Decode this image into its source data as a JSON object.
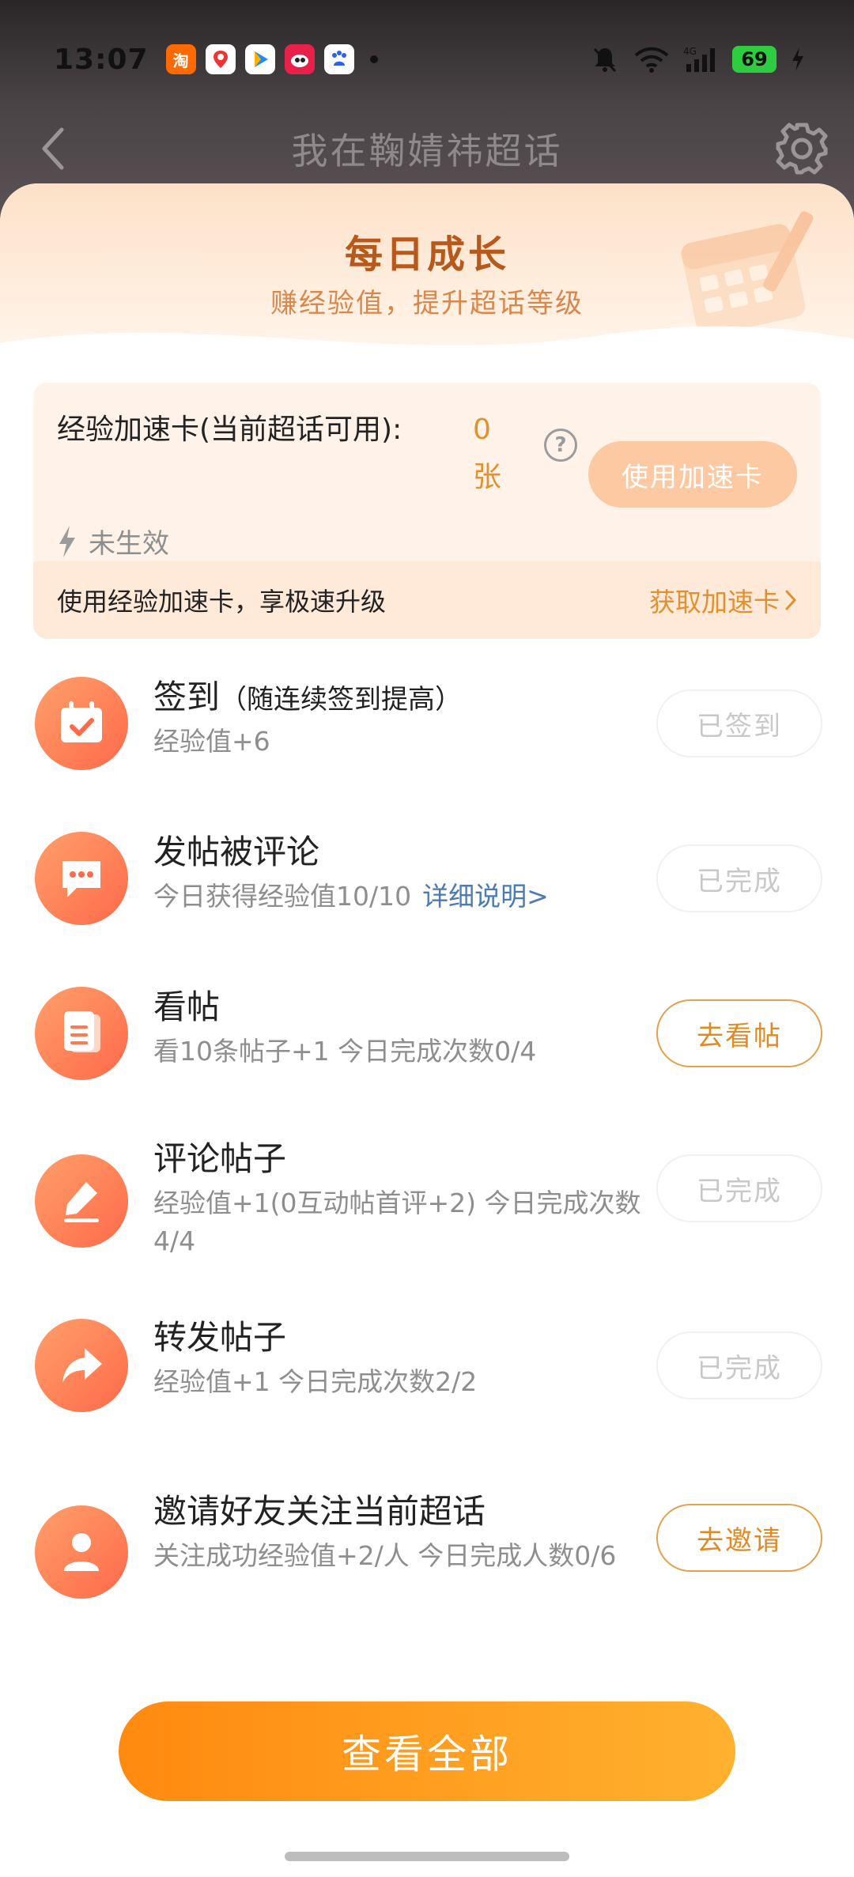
{
  "status_bar": {
    "time": "13:07",
    "battery": "69",
    "notification_icons": [
      "taobao-icon",
      "map-icon",
      "video-icon",
      "weibo-icon",
      "baidu-icon"
    ],
    "network": "4G"
  },
  "nav": {
    "title": "我在鞠婧祎超话"
  },
  "header": {
    "title": "每日成长",
    "subtitle": "赚经验值，提升超话等级"
  },
  "accelerator_card": {
    "label": "经验加速卡(当前超话可用):",
    "count": "0",
    "unit": "张",
    "use_button": "使用加速卡",
    "status": "未生效",
    "promo_text": "使用经验加速卡，享极速升级",
    "get_link": "获取加速卡"
  },
  "tasks": [
    {
      "title": "签到",
      "note": "（随连续签到提高）",
      "desc": "经验值+6",
      "link": "",
      "button": "已签到",
      "state": "done",
      "icon": "calendar-check-icon"
    },
    {
      "title": "发帖被评论",
      "note": "",
      "desc": "今日获得经验值10/10",
      "link": "详细说明>",
      "button": "已完成",
      "state": "done",
      "icon": "chat-bubble-icon"
    },
    {
      "title": "看帖",
      "note": "",
      "desc": "看10条帖子+1  今日完成次数0/4",
      "link": "",
      "button": "去看帖",
      "state": "go",
      "icon": "document-icon"
    },
    {
      "title": "评论帖子",
      "note": "",
      "desc": "经验值+1(0互动帖首评+2)  今日完成次数4/4",
      "link": "",
      "button": "已完成",
      "state": "done",
      "icon": "pencil-icon"
    },
    {
      "title": "转发帖子",
      "note": "",
      "desc": "经验值+1  今日完成次数2/2",
      "link": "",
      "button": "已完成",
      "state": "done",
      "icon": "share-arrow-icon"
    },
    {
      "title": "邀请好友关注当前超话",
      "note": "",
      "desc": "关注成功经验值+2/人  今日完成人数0/6",
      "link": "",
      "button": "去邀请",
      "state": "go",
      "icon": "person-icon"
    }
  ],
  "view_all_button": "查看全部",
  "colors": {
    "accent_orange": "#e3912f",
    "button_gradient_start": "#ff8a10",
    "button_gradient_end": "#ffb12f",
    "icon_gradient": "#ff6a4a",
    "link_blue": "#4a7bb5"
  }
}
